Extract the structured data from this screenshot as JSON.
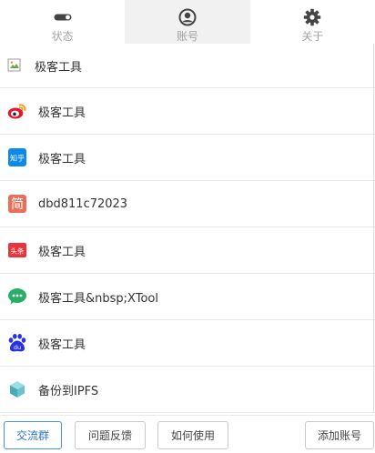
{
  "tabs": [
    {
      "label": "状态",
      "icon": "toggle-icon",
      "active": false
    },
    {
      "label": "账号",
      "icon": "account-circle-icon",
      "active": true
    },
    {
      "label": "关于",
      "icon": "gear-icon",
      "active": false
    }
  ],
  "accounts": [
    {
      "label": "极客工具",
      "icon": "broken-image-icon"
    },
    {
      "label": "极客工具",
      "icon": "weibo-icon"
    },
    {
      "label": "极客工具",
      "icon": "zhihu-icon",
      "icon_text": "知乎"
    },
    {
      "label": "dbd811c72023",
      "icon": "jianshu-icon",
      "icon_text": "简"
    },
    {
      "label": "极客工具",
      "icon": "toutiao-icon",
      "icon_text": "头条"
    },
    {
      "label": "极客工具&nbsp;XTool",
      "icon": "wechat-icon"
    },
    {
      "label": "极客工具",
      "icon": "baidu-icon",
      "icon_text": "du"
    },
    {
      "label": "备份到IPFS",
      "icon": "ipfs-cube-icon"
    }
  ],
  "footer": {
    "group_label": "交流群",
    "feedback_label": "问题反馈",
    "howto_label": "如何使用",
    "add_account_label": "添加账号"
  },
  "colors": {
    "accent": "#4a90e2",
    "weibo": "#e6162d",
    "zhihu": "#0f88eb",
    "jianshu": "#ea6f5a",
    "toutiao": "#e8353b",
    "wechat": "#2aae67",
    "baidu": "#2932e1"
  }
}
